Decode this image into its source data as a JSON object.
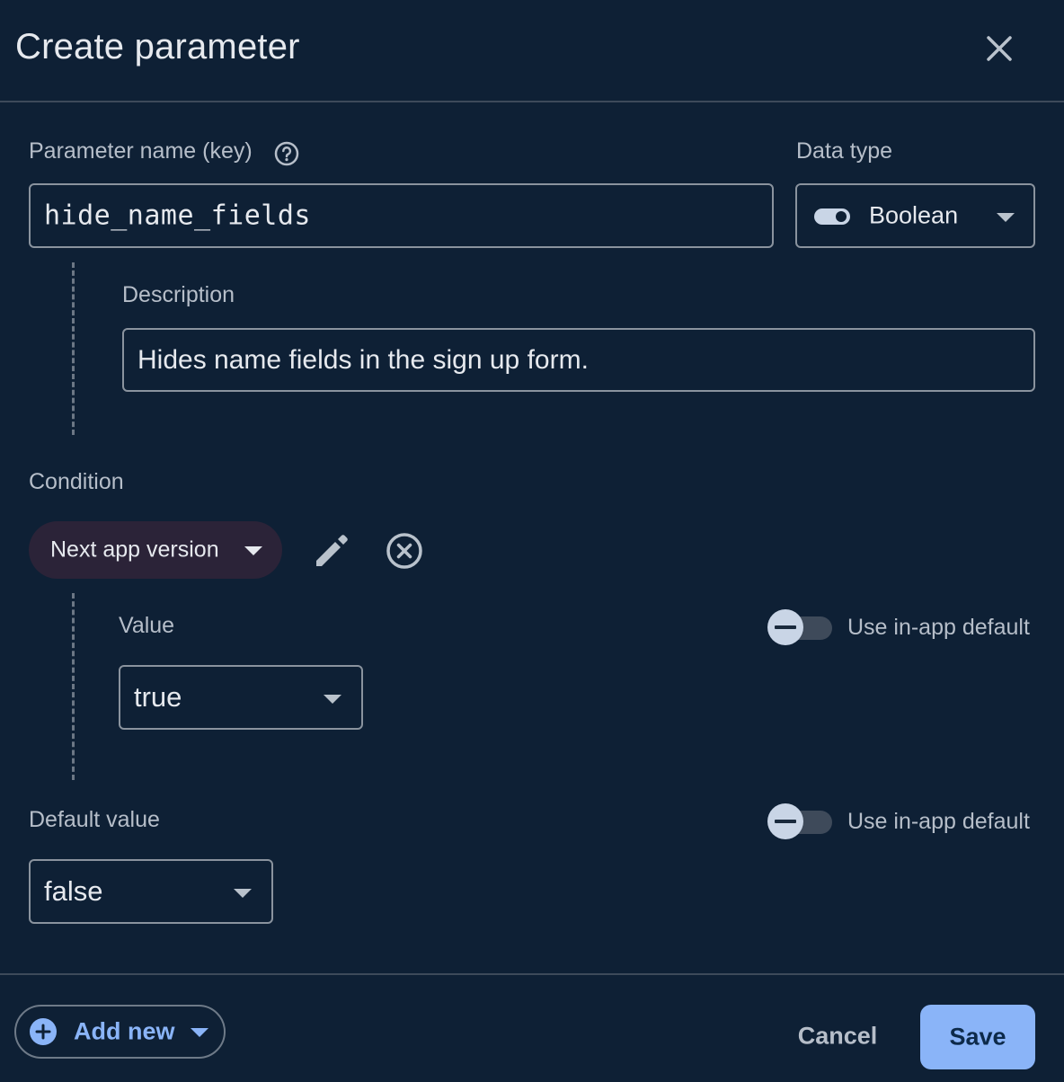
{
  "dialog": {
    "title": "Create parameter",
    "close_icon": "close-icon"
  },
  "param": {
    "name_label": "Parameter name (key)",
    "name_value": "hide_name_fields",
    "help_icon": "help-circle-icon",
    "data_type_label": "Data type",
    "data_type_value": "Boolean",
    "data_type_icon": "toggle-icon",
    "description_label": "Description",
    "description_value": "Hides name fields in the sign up form."
  },
  "condition": {
    "label": "Condition",
    "chip_label": "Next app version",
    "edit_icon": "pencil-icon",
    "remove_icon": "cancel-circle-icon",
    "value_label": "Value",
    "value_selected": "true",
    "in_app_default_label": "Use in-app default",
    "in_app_default_on": false
  },
  "default": {
    "label": "Default value",
    "value_selected": "false",
    "in_app_default_label": "Use in-app default",
    "in_app_default_on": false
  },
  "footer": {
    "add_new_label": "Add new",
    "cancel_label": "Cancel",
    "save_label": "Save"
  },
  "colors": {
    "background": "#0e2035",
    "accent": "#8ab4f8",
    "chip": "#2b2338"
  }
}
